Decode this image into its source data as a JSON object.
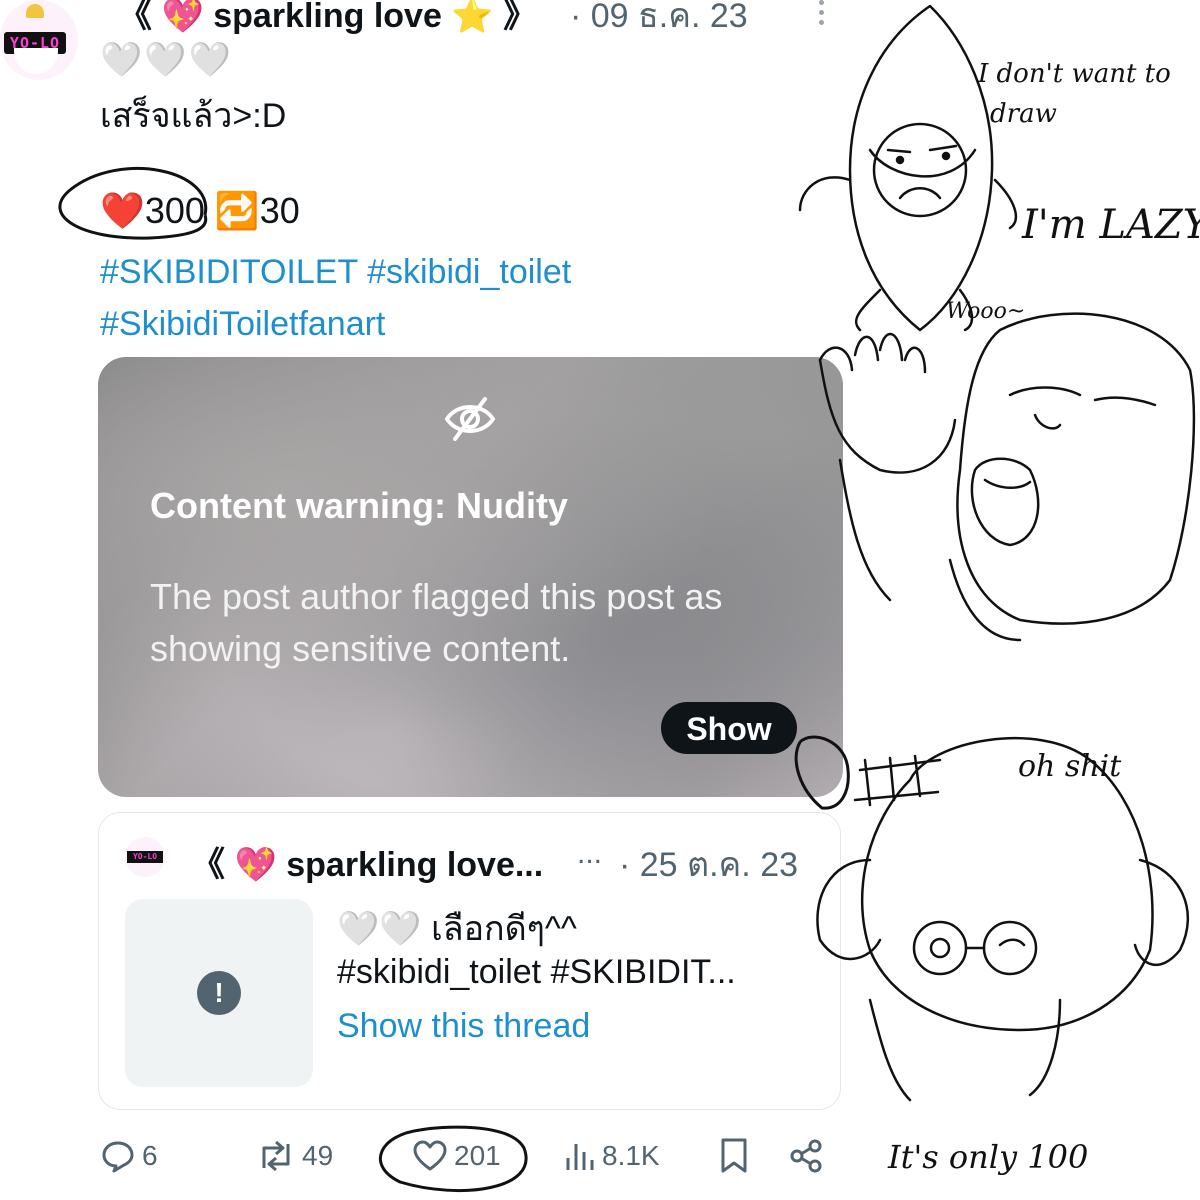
{
  "post": {
    "author": "《 💖 sparkling love ⭐ 》",
    "date": "· 09 ธ.ค. 23",
    "hearts_row": "🤍🤍🤍",
    "text": "เสร็จแล้ว>:D",
    "stats": "❤️300 🔁30",
    "hashtags_line1": "#SKIBIDITOILET #skibidi_toilet",
    "hashtags_line2": "#SkibidiToiletfanart"
  },
  "warning": {
    "title": "Content warning: Nudity",
    "body": "The post author flagged this post as showing sensitive content.",
    "show_label": "Show"
  },
  "quote": {
    "author": "《 💖 sparkling love...",
    "ellipsis": "...",
    "date": "· 25 ต.ค. 23",
    "line1_hearts": "🤍🤍",
    "line1_text": " เลือกดีๆ^^",
    "line2": "#skibidi_toilet #SKIBIDIT...",
    "link": "Show this thread"
  },
  "actions": {
    "replies": "6",
    "reposts": "49",
    "likes": "201",
    "views": "8.1K"
  },
  "drawing_text": {
    "t1a": "I don't want to",
    "t1b": "draw",
    "t2": "I'm LAZY",
    "t3": "Wooo~",
    "t4": "oh shit",
    "t5": "It's only 100"
  },
  "icons": [
    "more-icon",
    "eye-off-icon",
    "alert-icon",
    "reply-icon",
    "repost-icon",
    "like-icon",
    "views-icon",
    "bookmark-icon",
    "share-icon"
  ],
  "colors": {
    "link": "#1d8fcf",
    "muted": "#536471",
    "button": "#0f1419"
  }
}
